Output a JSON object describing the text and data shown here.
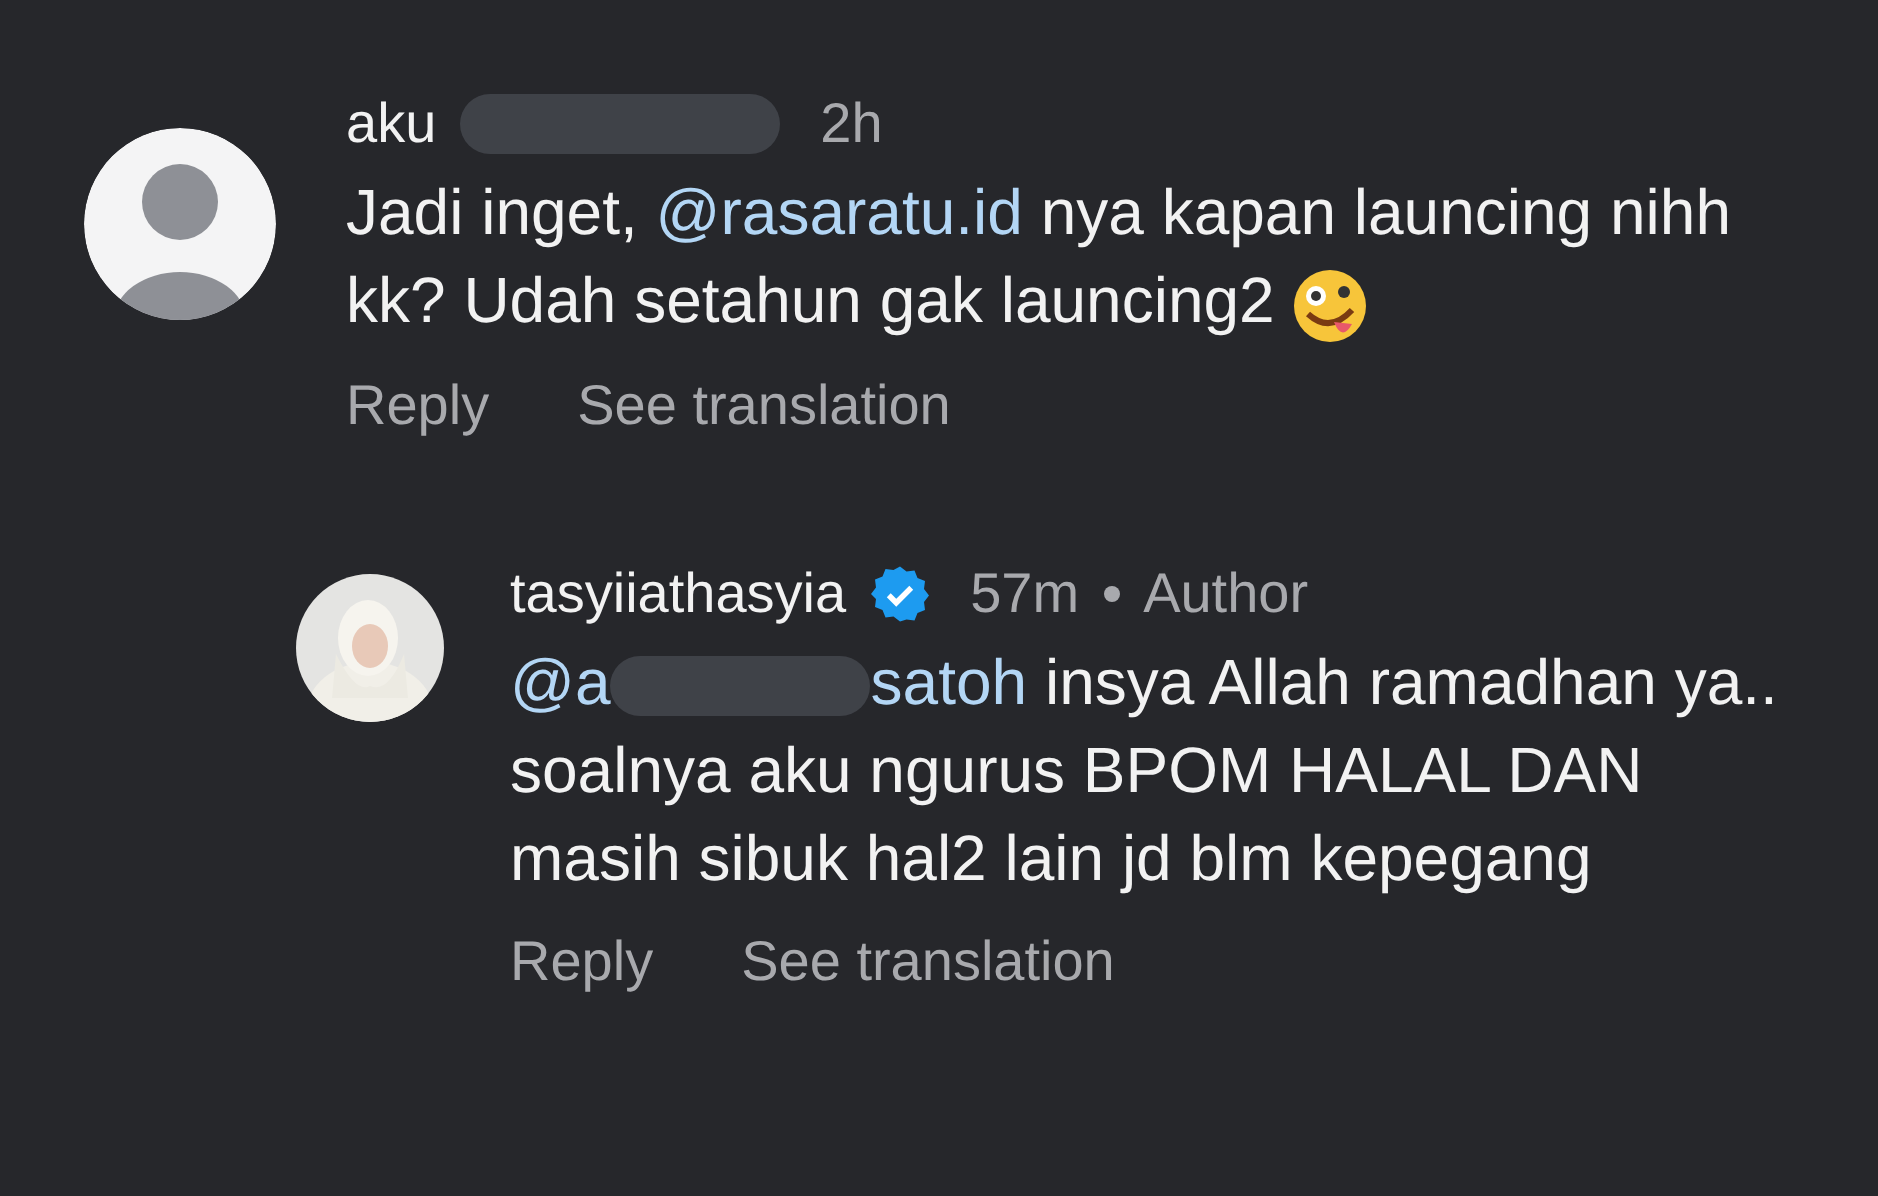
{
  "comments": [
    {
      "username_start": "aku",
      "time": "2h",
      "avatar": {
        "kind": "placeholder"
      },
      "verified": false,
      "text": [
        {
          "kind": "plain",
          "text": "Jadi inget, "
        },
        {
          "kind": "mention",
          "text": "@rasaratu.id"
        },
        {
          "kind": "plain",
          "text": " nya kapan launcing nihh kk? Udah setahun gak launcing2"
        }
      ],
      "emoji": true,
      "actions": [
        "Reply",
        "See translation"
      ],
      "reply": false
    },
    {
      "username": "tasyiiathasyia",
      "time": "57m",
      "avatar": {
        "kind": "picture"
      },
      "verified": true,
      "author_label": "Author",
      "text": [
        {
          "kind": "mention",
          "text": "@a"
        },
        {
          "kind": "redacted"
        },
        {
          "kind": "mention",
          "text": "satoh"
        },
        {
          "kind": "plain",
          "text": " insya Allah ramadhan ya.. soalnya aku ngurus BPOM HALAL DAN masih sibuk hal2 lain jd blm kepegang"
        }
      ],
      "emoji": false,
      "actions": [
        "Reply",
        "See translation"
      ],
      "reply": true
    }
  ]
}
